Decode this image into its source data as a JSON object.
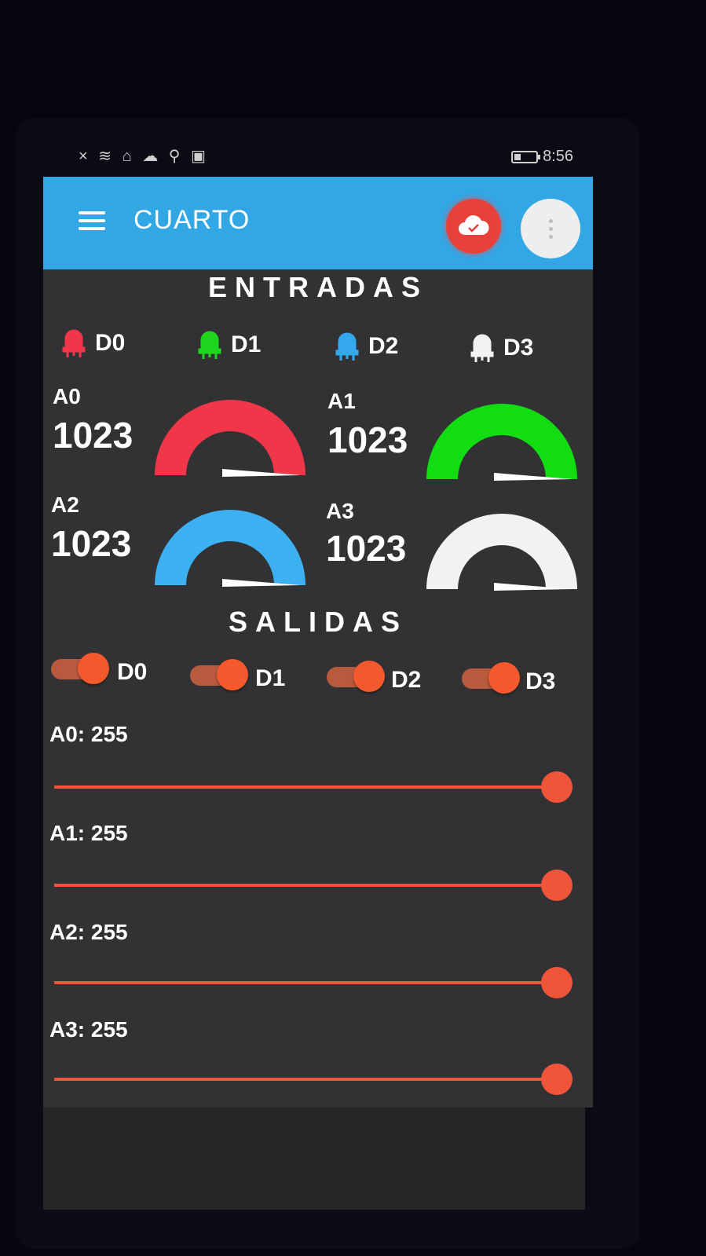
{
  "status_bar": {
    "time": "8:56",
    "icons": [
      "close-icon",
      "wifi-icon",
      "home-icon",
      "cloud-icon",
      "location-icon",
      "image-icon",
      "battery-icon"
    ]
  },
  "appbar": {
    "title": "CUARTO",
    "color": "#31a7e6",
    "cloud_button_color": "#e8403a"
  },
  "entradas": {
    "title": "ENTRADAS",
    "leds": [
      {
        "label": "D0",
        "color": "#f0374a"
      },
      {
        "label": "D1",
        "color": "#1ed61e"
      },
      {
        "label": "D2",
        "color": "#35a9ef"
      },
      {
        "label": "D3",
        "color": "#f2f2f2"
      }
    ],
    "gauges": [
      {
        "label": "A0",
        "value": "1023",
        "color": "#f0374a",
        "level": 1.0
      },
      {
        "label": "A1",
        "value": "1023",
        "color": "#12dd12",
        "level": 1.0
      },
      {
        "label": "A2",
        "value": "1023",
        "color": "#3db0f2",
        "level": 1.0
      },
      {
        "label": "A3",
        "value": "1023",
        "color": "#f2f2f2",
        "level": 1.0
      }
    ]
  },
  "salidas": {
    "title": "SALIDAS",
    "toggles": [
      {
        "label": "D0",
        "on": true
      },
      {
        "label": "D1",
        "on": true
      },
      {
        "label": "D2",
        "on": true
      },
      {
        "label": "D3",
        "on": true
      }
    ],
    "sliders": [
      {
        "label": "A0: 255",
        "value": 255,
        "max": 255
      },
      {
        "label": "A1: 255",
        "value": 255,
        "max": 255
      },
      {
        "label": "A2: 255",
        "value": 255,
        "max": 255
      },
      {
        "label": "A3: 255",
        "value": 255,
        "max": 255
      }
    ],
    "accent_color": "#f0553a"
  }
}
